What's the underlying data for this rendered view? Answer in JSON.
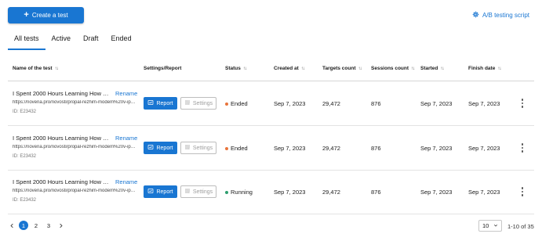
{
  "toolbar": {
    "create_label": "Create a test",
    "ab_link_label": "A/B testing script"
  },
  "tabs": [
    {
      "label": "All tests",
      "active": true
    },
    {
      "label": "Active",
      "active": false
    },
    {
      "label": "Draft",
      "active": false
    },
    {
      "label": "Ended",
      "active": false
    }
  ],
  "columns": {
    "name": "Name of the test",
    "settings_report": "Settings/Report",
    "status": "Status",
    "created_at": "Created at",
    "targets_count": "Targets count",
    "sessions_count": "Sessions count",
    "started": "Started",
    "finish_date": "Finish date"
  },
  "rows": [
    {
      "title": "I Spent 2000 Hours Learning How To Learn: P...",
      "rename": "Rename",
      "url": "https://novena.pro/novosti/propal-rezhim-modem%20v-iphone",
      "id": "ID: E23432",
      "report": "Report",
      "settings": "Settings",
      "status": "Ended",
      "status_color": "#e8743b",
      "created_at": "Sep 7, 2023",
      "targets_count": "29,472",
      "sessions_count": "876",
      "started": "Sep 7, 2023",
      "finish_date": "Sep 7, 2023"
    },
    {
      "title": "I Spent 2000 Hours Learning How To Learn: P...",
      "rename": "Rename",
      "url": "https://novena.pro/novosti/propal-rezhim-modem%20v-iphone",
      "id": "ID: E23432",
      "report": "Report",
      "settings": "Settings",
      "status": "Ended",
      "status_color": "#e8743b",
      "created_at": "Sep 7, 2023",
      "targets_count": "29,472",
      "sessions_count": "876",
      "started": "Sep 7, 2023",
      "finish_date": "Sep 7, 2023"
    },
    {
      "title": "I Spent 2000 Hours Learning How To Learn: P...",
      "rename": "Rename",
      "url": "https://novena.pro/novosti/propal-rezhim-modem%20v-iphone",
      "id": "ID: E23432",
      "report": "Report",
      "settings": "Settings",
      "status": "Running",
      "status_color": "#2e9e6e",
      "created_at": "Sep 7, 2023",
      "targets_count": "29,472",
      "sessions_count": "876",
      "started": "Sep 7, 2023",
      "finish_date": "Sep 7, 2023"
    }
  ],
  "pagination": {
    "pages": [
      "1",
      "2",
      "3"
    ],
    "current": "1",
    "per_page": "10",
    "range": "1-10 of 35"
  },
  "colors": {
    "accent": "#1976d2",
    "ended": "#e8743b",
    "running": "#2e9e6e"
  },
  "icons": {
    "create": "plus-icon",
    "ab_link": "gear-icon",
    "report": "report-icon",
    "settings": "sliders-icon",
    "row_menu": "more-vertical-icon",
    "prev": "chevron-left-icon",
    "next": "chevron-right-icon",
    "per_page": "chevron-down-icon"
  }
}
